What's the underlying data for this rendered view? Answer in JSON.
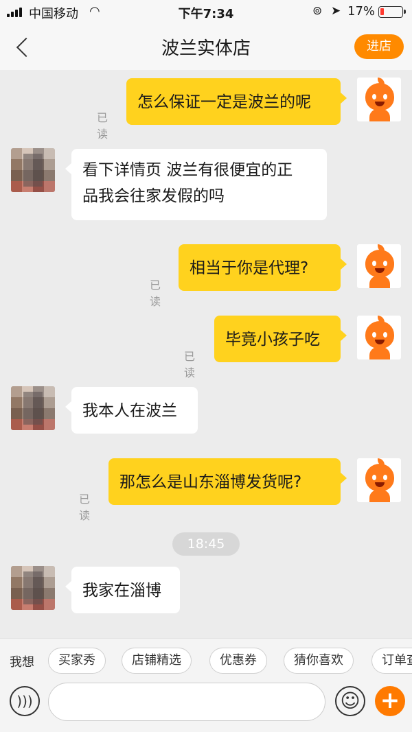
{
  "status_bar": {
    "carrier": "中国移动",
    "time": "下午7:34",
    "battery": "17%",
    "battery_level": 0.17
  },
  "header": {
    "back_icon": "chevron-left-icon",
    "title": "波兰实体店",
    "enter_shop_label": "进店"
  },
  "messages": [
    {
      "side": "out",
      "text": "怎么保证一定是波兰的呢",
      "read": "已读"
    },
    {
      "side": "in",
      "lines": [
        "看下详情页 波兰有很便宜的正",
        "品我会往家发假的吗"
      ]
    },
    {
      "side": "out",
      "text": "相当于你是代理?",
      "read": "已读"
    },
    {
      "side": "out",
      "text": "毕竟小孩子吃",
      "read": "已读"
    },
    {
      "side": "in",
      "text": "我本人在波兰"
    },
    {
      "side": "out",
      "text": "那怎么是山东淄博发货呢?",
      "read": "已读"
    },
    {
      "side": "in",
      "text": "我家在淄博"
    }
  ],
  "timestamp": "18:45",
  "quick_bar": {
    "lead": "我想",
    "chips": [
      "买家秀",
      "店铺精选",
      "优惠券",
      "猜你喜欢",
      "订单查"
    ]
  },
  "input_bar": {
    "voice_icon": "voice-icon",
    "emoji_icon": "emoji-icon",
    "plus_icon": "plus-icon"
  },
  "colors": {
    "accent": "#ff8a00",
    "outgoing_bubble": "#ffd21e",
    "incoming_bubble": "#ffffff",
    "background": "#ececec"
  }
}
